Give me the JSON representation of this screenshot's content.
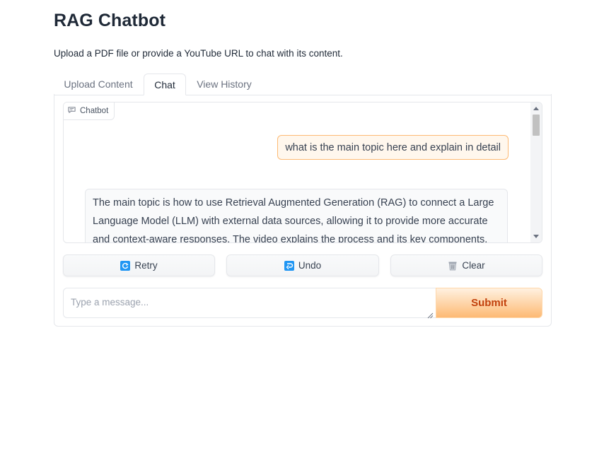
{
  "app": {
    "title": "RAG Chatbot",
    "subtitle": "Upload a PDF file or provide a YouTube URL to chat with its content."
  },
  "tabs": [
    {
      "label": "Upload Content",
      "active": false
    },
    {
      "label": "Chat",
      "active": true
    },
    {
      "label": "View History",
      "active": false
    }
  ],
  "chatbot": {
    "label": "Chatbot",
    "messages": [
      {
        "role": "user",
        "text": "what is the main topic here and explain in detail"
      },
      {
        "role": "bot",
        "text": "The main topic is how to use Retrieval Augmented Generation (RAG) to connect a Large Language Model (LLM) with external data sources, allowing it to provide more accurate and context-aware responses. The video explains the process and its key components."
      }
    ]
  },
  "actions": {
    "retry_label": "Retry",
    "undo_label": "Undo",
    "clear_label": "Clear"
  },
  "input": {
    "placeholder": "Type a message...",
    "value": ""
  },
  "submit_label": "Submit",
  "colors": {
    "accent": "#fdba74",
    "submit_text": "#c2410c",
    "user_bubble": "#fff7ed",
    "icon_blue": "#2196f3"
  }
}
